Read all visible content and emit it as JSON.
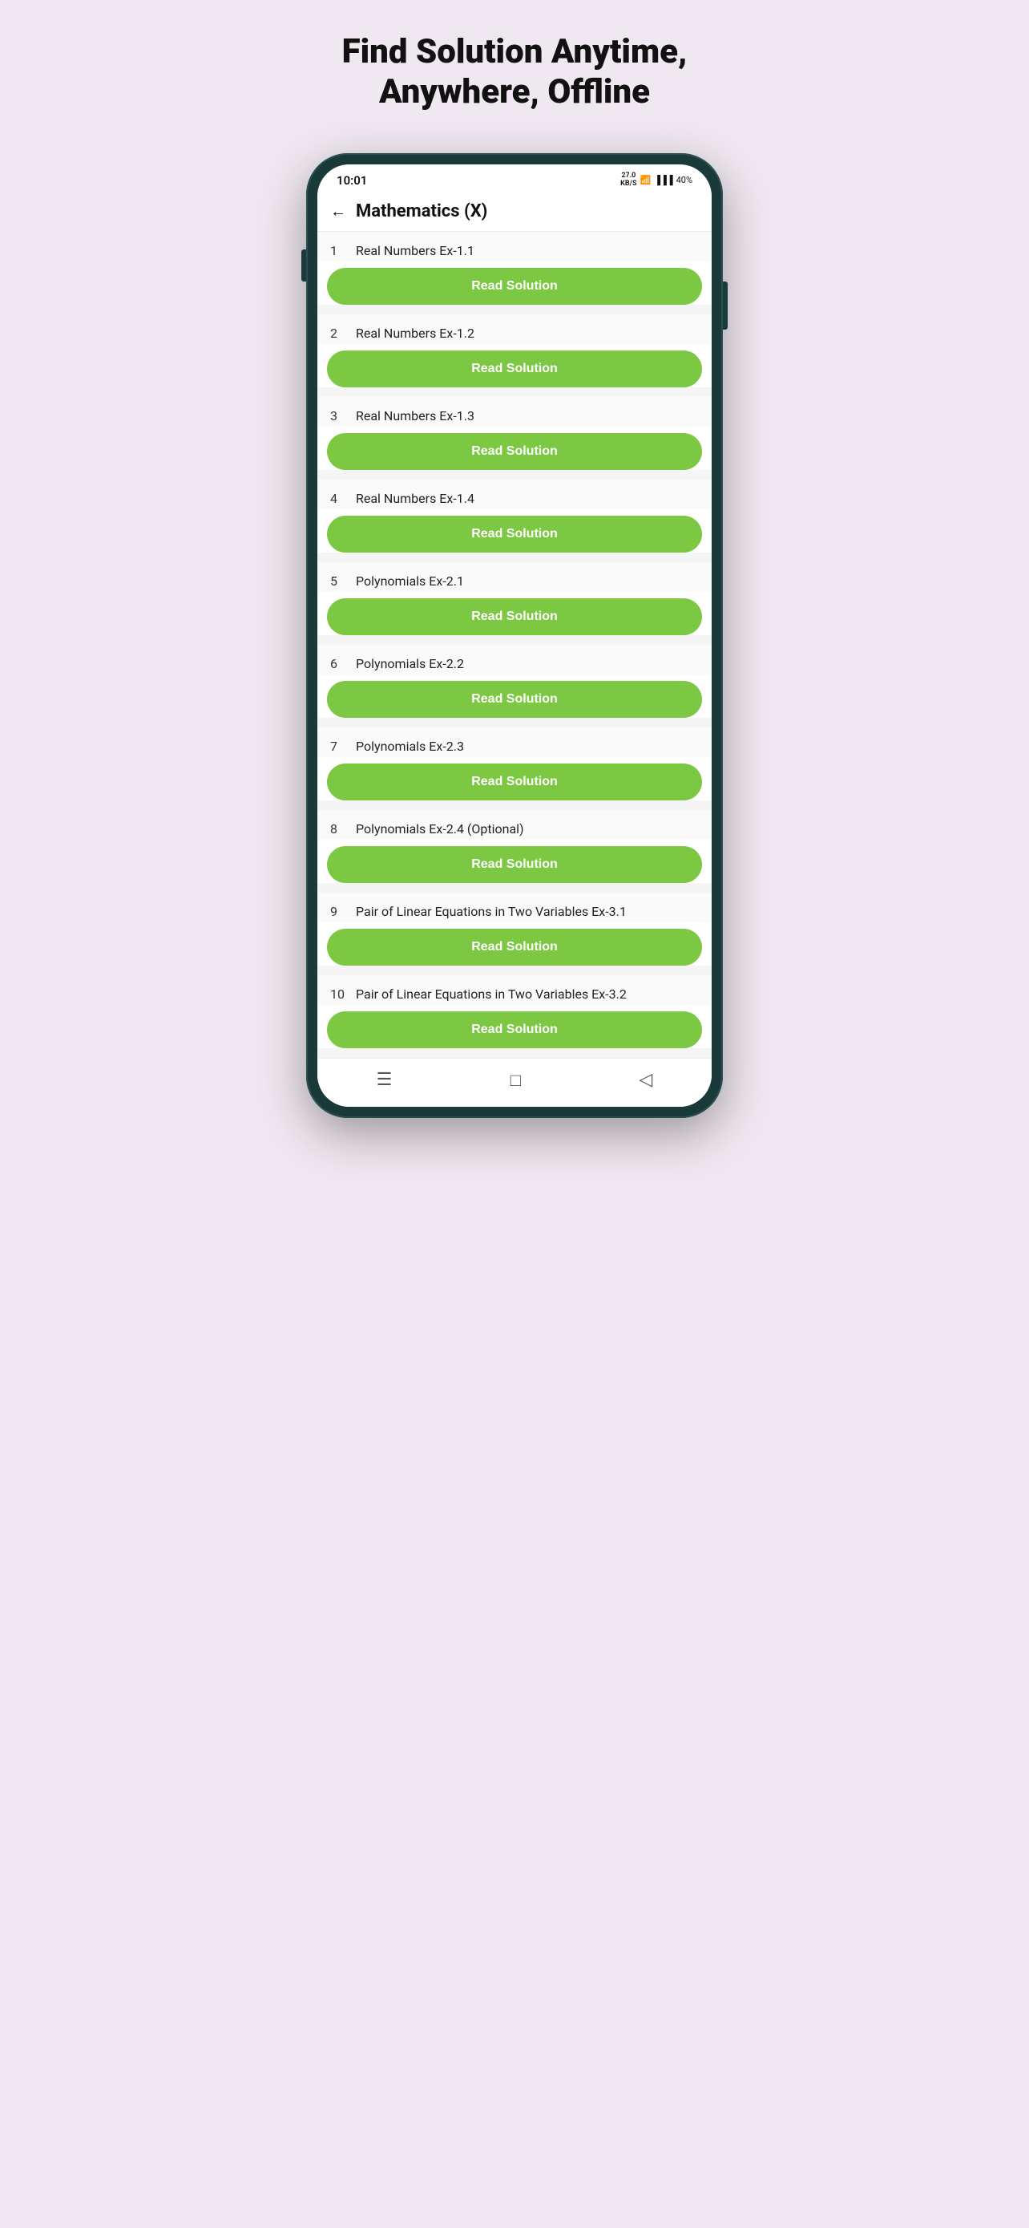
{
  "page": {
    "headline_line1": "Find Solution Anytime,",
    "headline_line2": "Anywhere, Offline"
  },
  "status_bar": {
    "time": "10:01",
    "data_speed_top": "27.0",
    "data_speed_bot": "KB/S",
    "battery": "40%"
  },
  "app_header": {
    "back_label": "←",
    "title": "Mathematics (X)"
  },
  "read_solution_label": "Read Solution",
  "items": [
    {
      "number": "1",
      "title": "Real Numbers Ex-1.1"
    },
    {
      "number": "2",
      "title": "Real Numbers Ex-1.2"
    },
    {
      "number": "3",
      "title": "Real Numbers Ex-1.3"
    },
    {
      "number": "4",
      "title": "Real Numbers Ex-1.4"
    },
    {
      "number": "5",
      "title": "Polynomials Ex-2.1"
    },
    {
      "number": "6",
      "title": "Polynomials Ex-2.2"
    },
    {
      "number": "7",
      "title": "Polynomials Ex-2.3"
    },
    {
      "number": "8",
      "title": "Polynomials Ex-2.4 (Optional)"
    },
    {
      "number": "9",
      "title": "Pair of Linear Equations in Two Variables Ex-3.1"
    },
    {
      "number": "10",
      "title": "Pair of Linear Equations in Two Variables Ex-3.2"
    }
  ],
  "bottom_nav": {
    "menu_icon": "☰",
    "home_icon": "□",
    "back_icon": "◁"
  }
}
